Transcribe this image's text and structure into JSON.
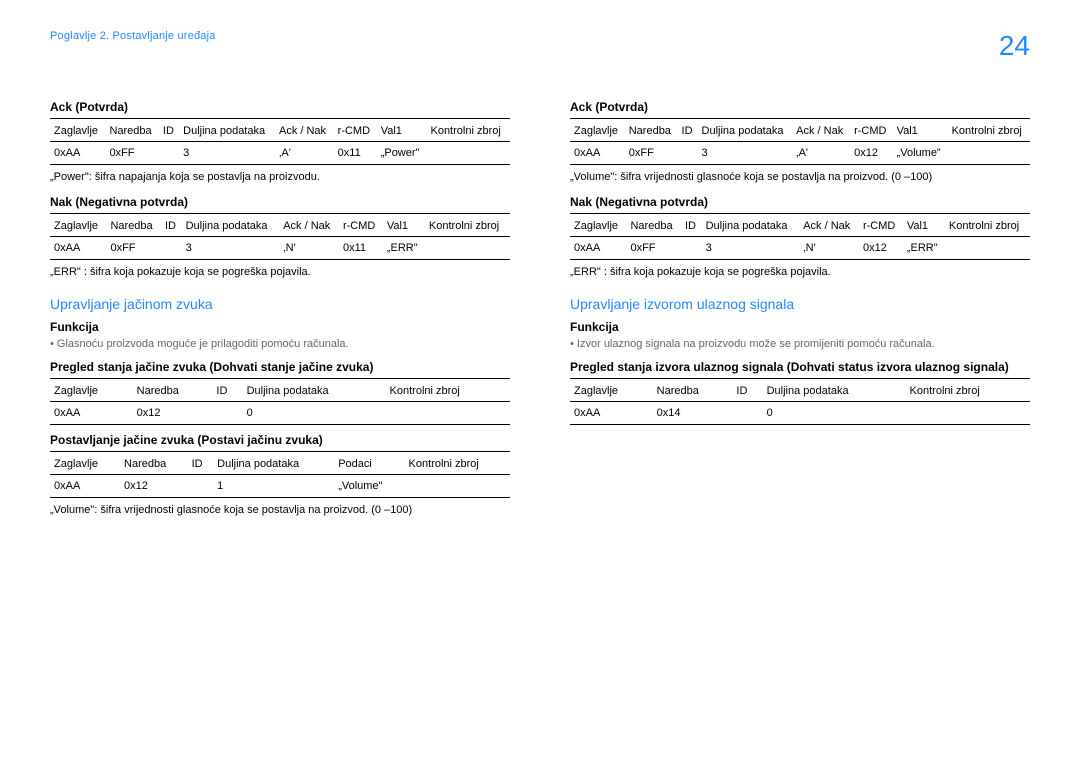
{
  "header": {
    "chapter": "Poglavlje 2. Postavljanje uređaja",
    "page": "24"
  },
  "hdr8": [
    "Zaglavlje",
    "Naredba",
    "ID",
    "Duljina podataka",
    "Ack / Nak",
    "r-CMD",
    "Val1",
    "Kontrolni zbroj"
  ],
  "hdr5a": [
    "Zaglavlje",
    "Naredba",
    "ID",
    "Duljina podataka",
    "Kontrolni zbroj"
  ],
  "hdr6": [
    "Zaglavlje",
    "Naredba",
    "ID",
    "Duljina podataka",
    "Podaci",
    "Kontrolni zbroj"
  ],
  "left": {
    "ack_title": "Ack (Potvrda)",
    "ack_row": [
      "0xAA",
      "0xFF",
      "",
      "3",
      "‚A'",
      "0x11",
      "„Power\"",
      ""
    ],
    "ack_note": "„Power\": šifra napajanja koja se postavlja na proizvodu.",
    "nak_title": "Nak (Negativna potvrda)",
    "nak_row": [
      "0xAA",
      "0xFF",
      "",
      "3",
      "‚N'",
      "0x11",
      "„ERR\"",
      ""
    ],
    "nak_note": "„ERR\" : šifra koja pokazuje koja se pogreška pojavila.",
    "section": "Upravljanje jačinom zvuka",
    "funk_title": "Funkcija",
    "funk_bullet": "Glasnoću proizvoda moguće je prilagoditi pomoću računala.",
    "get_title": "Pregled stanja jačine zvuka (Dohvati stanje jačine zvuka)",
    "get_row": [
      "0xAA",
      "0x12",
      "",
      "0",
      ""
    ],
    "set_title": "Postavljanje jačine zvuka (Postavi jačinu zvuka)",
    "set_row": [
      "0xAA",
      "0x12",
      "",
      "1",
      "„Volume\"",
      ""
    ],
    "set_note": "„Volume\": šifra vrijednosti glasnoće koja se postavlja na proizvod. (0 –100)"
  },
  "right": {
    "ack_title": "Ack (Potvrda)",
    "ack_row": [
      "0xAA",
      "0xFF",
      "",
      "3",
      "‚A'",
      "0x12",
      "„Volume\"",
      ""
    ],
    "ack_note": "„Volume\": šifra vrijednosti glasnoće koja se postavlja na proizvod. (0 –100)",
    "nak_title": "Nak (Negativna potvrda)",
    "nak_row": [
      "0xAA",
      "0xFF",
      "",
      "3",
      "‚N'",
      "0x12",
      "„ERR\"",
      ""
    ],
    "nak_note": "„ERR\" : šifra koja pokazuje koja se pogreška pojavila.",
    "section": "Upravljanje izvorom ulaznog signala",
    "funk_title": "Funkcija",
    "funk_bullet": "Izvor ulaznog signala na proizvodu može se promijeniti pomoću računala.",
    "get_title": "Pregled stanja izvora ulaznog signala (Dohvati status izvora ulaznog signala)",
    "get_row": [
      "0xAA",
      "0x14",
      "",
      "0",
      ""
    ]
  }
}
